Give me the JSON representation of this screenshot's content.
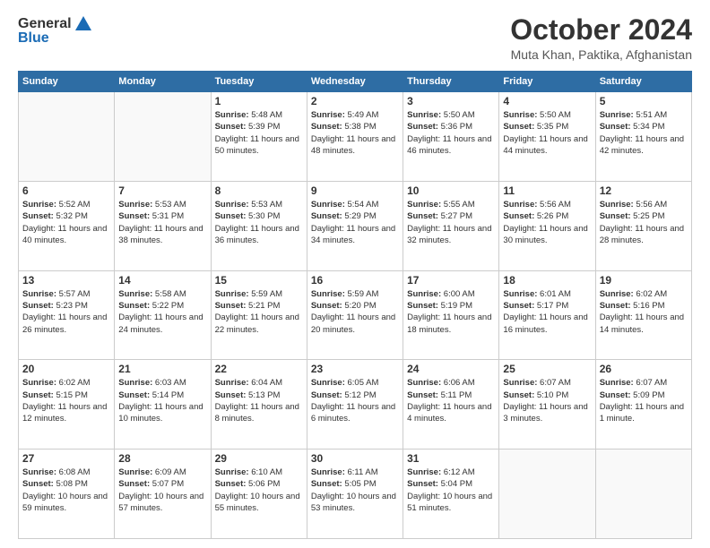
{
  "header": {
    "logo_general": "General",
    "logo_blue": "Blue",
    "month_title": "October 2024",
    "location": "Muta Khan, Paktika, Afghanistan"
  },
  "weekdays": [
    "Sunday",
    "Monday",
    "Tuesday",
    "Wednesday",
    "Thursday",
    "Friday",
    "Saturday"
  ],
  "weeks": [
    [
      {
        "day": "",
        "text": ""
      },
      {
        "day": "",
        "text": ""
      },
      {
        "day": "1",
        "text": "Sunrise: 5:48 AM\nSunset: 5:39 PM\nDaylight: 11 hours and 50 minutes."
      },
      {
        "day": "2",
        "text": "Sunrise: 5:49 AM\nSunset: 5:38 PM\nDaylight: 11 hours and 48 minutes."
      },
      {
        "day": "3",
        "text": "Sunrise: 5:50 AM\nSunset: 5:36 PM\nDaylight: 11 hours and 46 minutes."
      },
      {
        "day": "4",
        "text": "Sunrise: 5:50 AM\nSunset: 5:35 PM\nDaylight: 11 hours and 44 minutes."
      },
      {
        "day": "5",
        "text": "Sunrise: 5:51 AM\nSunset: 5:34 PM\nDaylight: 11 hours and 42 minutes."
      }
    ],
    [
      {
        "day": "6",
        "text": "Sunrise: 5:52 AM\nSunset: 5:32 PM\nDaylight: 11 hours and 40 minutes."
      },
      {
        "day": "7",
        "text": "Sunrise: 5:53 AM\nSunset: 5:31 PM\nDaylight: 11 hours and 38 minutes."
      },
      {
        "day": "8",
        "text": "Sunrise: 5:53 AM\nSunset: 5:30 PM\nDaylight: 11 hours and 36 minutes."
      },
      {
        "day": "9",
        "text": "Sunrise: 5:54 AM\nSunset: 5:29 PM\nDaylight: 11 hours and 34 minutes."
      },
      {
        "day": "10",
        "text": "Sunrise: 5:55 AM\nSunset: 5:27 PM\nDaylight: 11 hours and 32 minutes."
      },
      {
        "day": "11",
        "text": "Sunrise: 5:56 AM\nSunset: 5:26 PM\nDaylight: 11 hours and 30 minutes."
      },
      {
        "day": "12",
        "text": "Sunrise: 5:56 AM\nSunset: 5:25 PM\nDaylight: 11 hours and 28 minutes."
      }
    ],
    [
      {
        "day": "13",
        "text": "Sunrise: 5:57 AM\nSunset: 5:23 PM\nDaylight: 11 hours and 26 minutes."
      },
      {
        "day": "14",
        "text": "Sunrise: 5:58 AM\nSunset: 5:22 PM\nDaylight: 11 hours and 24 minutes."
      },
      {
        "day": "15",
        "text": "Sunrise: 5:59 AM\nSunset: 5:21 PM\nDaylight: 11 hours and 22 minutes."
      },
      {
        "day": "16",
        "text": "Sunrise: 5:59 AM\nSunset: 5:20 PM\nDaylight: 11 hours and 20 minutes."
      },
      {
        "day": "17",
        "text": "Sunrise: 6:00 AM\nSunset: 5:19 PM\nDaylight: 11 hours and 18 minutes."
      },
      {
        "day": "18",
        "text": "Sunrise: 6:01 AM\nSunset: 5:17 PM\nDaylight: 11 hours and 16 minutes."
      },
      {
        "day": "19",
        "text": "Sunrise: 6:02 AM\nSunset: 5:16 PM\nDaylight: 11 hours and 14 minutes."
      }
    ],
    [
      {
        "day": "20",
        "text": "Sunrise: 6:02 AM\nSunset: 5:15 PM\nDaylight: 11 hours and 12 minutes."
      },
      {
        "day": "21",
        "text": "Sunrise: 6:03 AM\nSunset: 5:14 PM\nDaylight: 11 hours and 10 minutes."
      },
      {
        "day": "22",
        "text": "Sunrise: 6:04 AM\nSunset: 5:13 PM\nDaylight: 11 hours and 8 minutes."
      },
      {
        "day": "23",
        "text": "Sunrise: 6:05 AM\nSunset: 5:12 PM\nDaylight: 11 hours and 6 minutes."
      },
      {
        "day": "24",
        "text": "Sunrise: 6:06 AM\nSunset: 5:11 PM\nDaylight: 11 hours and 4 minutes."
      },
      {
        "day": "25",
        "text": "Sunrise: 6:07 AM\nSunset: 5:10 PM\nDaylight: 11 hours and 3 minutes."
      },
      {
        "day": "26",
        "text": "Sunrise: 6:07 AM\nSunset: 5:09 PM\nDaylight: 11 hours and 1 minute."
      }
    ],
    [
      {
        "day": "27",
        "text": "Sunrise: 6:08 AM\nSunset: 5:08 PM\nDaylight: 10 hours and 59 minutes."
      },
      {
        "day": "28",
        "text": "Sunrise: 6:09 AM\nSunset: 5:07 PM\nDaylight: 10 hours and 57 minutes."
      },
      {
        "day": "29",
        "text": "Sunrise: 6:10 AM\nSunset: 5:06 PM\nDaylight: 10 hours and 55 minutes."
      },
      {
        "day": "30",
        "text": "Sunrise: 6:11 AM\nSunset: 5:05 PM\nDaylight: 10 hours and 53 minutes."
      },
      {
        "day": "31",
        "text": "Sunrise: 6:12 AM\nSunset: 5:04 PM\nDaylight: 10 hours and 51 minutes."
      },
      {
        "day": "",
        "text": ""
      },
      {
        "day": "",
        "text": ""
      }
    ]
  ]
}
